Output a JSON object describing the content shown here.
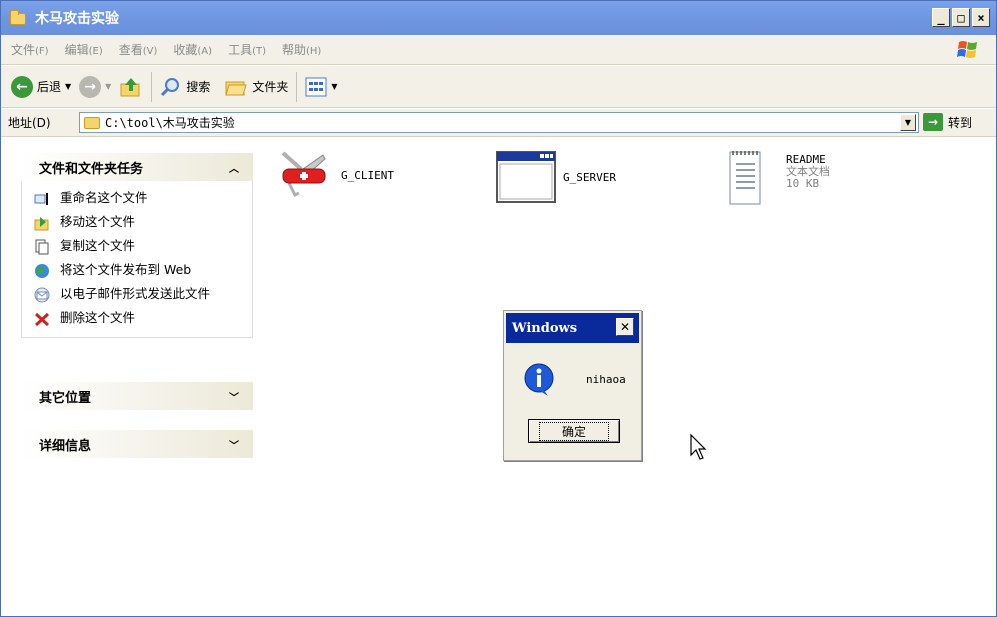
{
  "window": {
    "title": "木马攻击实验"
  },
  "menu": [
    {
      "label": "文件",
      "key": "(F)"
    },
    {
      "label": "编辑",
      "key": "(E)"
    },
    {
      "label": "查看",
      "key": "(V)"
    },
    {
      "label": "收藏",
      "key": "(A)"
    },
    {
      "label": "工具",
      "key": "(T)"
    },
    {
      "label": "帮助",
      "key": "(H)"
    }
  ],
  "toolbar": {
    "back": "后退",
    "search": "搜索",
    "folders": "文件夹"
  },
  "address": {
    "label": "地址(D)",
    "path": "C:\\tool\\木马攻击实验",
    "go": "转到"
  },
  "tasks": {
    "file_tasks_title": "文件和文件夹任务",
    "items": [
      "重命名这个文件",
      "移动这个文件",
      "复制这个文件",
      "将这个文件发布到 Web",
      "以电子邮件形式发送此文件",
      "删除这个文件"
    ],
    "other_places_title": "其它位置",
    "details_title": "详细信息"
  },
  "files": [
    {
      "name": "G_CLIENT"
    },
    {
      "name": "G_SERVER"
    },
    {
      "name": "README",
      "type": "文本文档",
      "size": "10 KB"
    }
  ],
  "dialog": {
    "title": "Windows",
    "message": "nihaoa",
    "ok": "确定"
  }
}
